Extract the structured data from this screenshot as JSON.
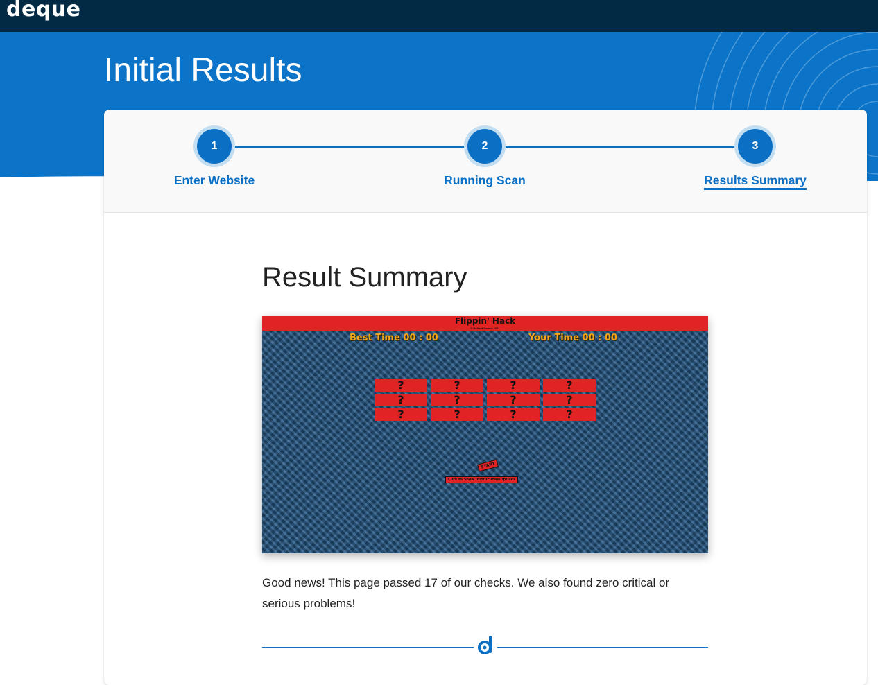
{
  "header": {
    "logo_text": "deque"
  },
  "page": {
    "title": "Initial Results"
  },
  "stepper": {
    "steps": [
      {
        "number": "1",
        "label": "Enter Website",
        "active": false
      },
      {
        "number": "2",
        "label": "Running Scan",
        "active": false
      },
      {
        "number": "3",
        "label": "Results Summary",
        "active": true
      }
    ]
  },
  "summary": {
    "title": "Result Summary",
    "message": "Good news! This page passed 17 of our checks. We also found zero critical or serious problems!"
  },
  "screenshot": {
    "game_title": "Flippin' Hack",
    "game_subtitle": "© Bullard Games 2021",
    "best_time": "Best Time 00 : 00",
    "your_time": "Your Time 00 : 00",
    "tiles": [
      "?",
      "?",
      "?",
      "?",
      "?",
      "?",
      "?",
      "?",
      "?",
      "?",
      "?",
      "?"
    ],
    "start_label": "START",
    "instructions_label": "Click to Show Instructions/Options"
  },
  "colors": {
    "topbar": "#032a44",
    "hero_blue": "#0b74c9",
    "accent": "#0b6fc4",
    "tile_red": "#e02424",
    "time_orange": "#f2a51a"
  }
}
